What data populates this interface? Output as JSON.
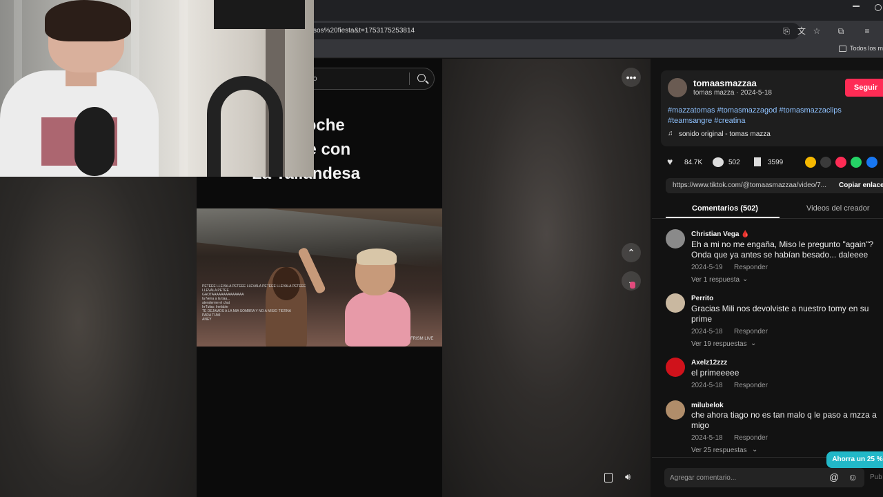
{
  "browser": {
    "url": "sos%20fiesta&t=1753175253814",
    "bookmarks_label": "Todos los ma"
  },
  "video_page": {
    "search_placeholder": "lo",
    "headline_lines": [
      "na la Noche",
      "o Anime con",
      "La Tailandesa"
    ],
    "clip_chat": [
      "PETEEE LLEVALA PETEEE LLEVALA PETEEE LLEVALA PETEEE",
      "LLEVALA PETEE",
      "GAOTAAAAAAAAAAAAAA",
      "la Nena a la tiaa...",
      "atenderme el chat",
      "IrrTufas: Inefable",
      "TE DEJAMOS A LA MIA SOMBRA Y NO A MISIO TIERNA",
      "PARA TUMI",
      "ANEY"
    ],
    "clip_watermark": "FRISM LIVE"
  },
  "creator": {
    "username": "tomaasmazzaa",
    "display": "tomas mazza · 2024-5-18",
    "follow_label": "Seguir",
    "hashtags_line1": "#mazzatomas #tomasmazzagod #tomasmazzaclips",
    "hashtags_line2": "#teamsangre #creatina",
    "sound": "sonido original - tomas mazza"
  },
  "stats": {
    "likes": "84.7K",
    "comments": "502",
    "saves": "3599"
  },
  "share_colors": [
    "#f5b800",
    "#3a3a3a",
    "#fe2c55",
    "#25d366",
    "#1877f2"
  ],
  "link": {
    "url": "https://www.tiktok.com/@tomaasmazzaa/video/7...",
    "copy_label": "Copiar enlace"
  },
  "tabs": {
    "comments": "Comentarios (502)",
    "creator_videos": "Videos del creador"
  },
  "comments": [
    {
      "name": "Christian Vega 🩸",
      "text": "Eh a mi no me engaña, Miso le pregunto \"again\"? Onda que ya antes se habían besado... daleeee",
      "date": "2024-5-19",
      "reply": "Responder",
      "replies": "Ver 1 respuesta",
      "avatar": "#8a8a8a"
    },
    {
      "name": "Perrito",
      "text": "Gracias Mili nos devolviste a nuestro tomy en su prime",
      "date": "2024-5-18",
      "reply": "Responder",
      "replies": "Ver 19 respuestas",
      "avatar": "#c9b8a0"
    },
    {
      "name": "Axelz12zzz",
      "text": "el primeeeee",
      "date": "2024-5-18",
      "reply": "Responder",
      "replies": "",
      "avatar": "#d0121b"
    },
    {
      "name": "milubelok",
      "text": "che ahora tiago no es tan malo q le paso a mzza a migo",
      "date": "2024-5-18",
      "reply": "Responder",
      "replies": "Ver 25 respuestas",
      "avatar": "#b08d6a"
    }
  ],
  "comment_input": {
    "placeholder": "Agregar comentario...",
    "post_label": "Pub"
  },
  "promo": "Ahorra un 25 %"
}
